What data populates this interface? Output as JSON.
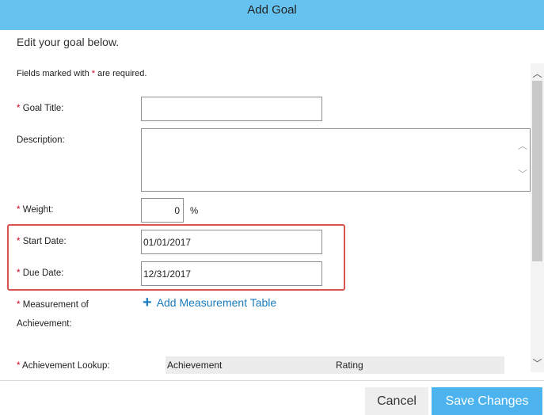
{
  "dialog": {
    "title": "Add Goal",
    "intro": "Edit your goal below.",
    "required_note_prefix": "Fields marked with",
    "required_star": "*",
    "required_note_suffix": "are required."
  },
  "form": {
    "goal_title_label": "Goal Title:",
    "goal_title_value": "",
    "description_label": "Description:",
    "description_value": "",
    "weight_label": "Weight:",
    "weight_value": "0",
    "weight_unit": "%",
    "start_date_label": "Start Date:",
    "start_date_value": "01/01/2017",
    "due_date_label": "Due Date:",
    "due_date_value": "12/31/2017",
    "measurement_label_line1": "Measurement of",
    "measurement_label_line2": "Achievement:",
    "add_measurement_label": "Add Measurement Table",
    "achievement_lookup_label": "Achievement Lookup:",
    "lookup_columns": [
      "Achievement",
      "Rating"
    ]
  },
  "footer": {
    "cancel_label": "Cancel",
    "save_label": "Save Changes"
  },
  "colors": {
    "header_bg": "#66c3f0",
    "required_star": "#d0021b",
    "highlight_border": "#d9534f",
    "link": "#1a7cbf",
    "save_button": "#4db3ef"
  },
  "icons": {
    "add": "plus-icon",
    "scroll_up": "chevron-up-icon",
    "scroll_down": "chevron-down-icon"
  }
}
